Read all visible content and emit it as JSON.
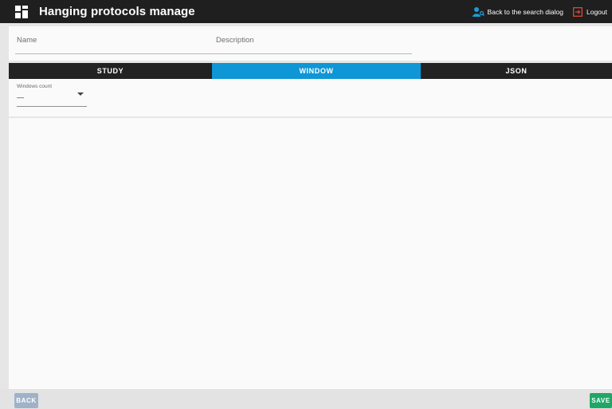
{
  "app": {
    "title": "Hanging protocols manage",
    "icon": "dashboard-icon"
  },
  "header": {
    "back_label": "Back to the search dialog",
    "back_icon": "user-search-icon",
    "logout_label": "Logout",
    "logout_icon": "logout-icon",
    "accent_icon_color": "#1e9bd7",
    "logout_icon_color": "#e74c3c"
  },
  "form": {
    "name_label": "Name",
    "name_value": "",
    "description_label": "Description",
    "description_value": ""
  },
  "tabs": [
    {
      "label": "STUDY",
      "active": false
    },
    {
      "label": "WINDOW",
      "active": true
    },
    {
      "label": "JSON",
      "active": false
    }
  ],
  "window": {
    "count_label": "Windows count",
    "count_value": "—",
    "count_arrow_icon": "dropdown-arrow-icon"
  },
  "footer": {
    "back_button": "BACK",
    "save_button": "SAVE"
  },
  "colors": {
    "topbar": "#1f1f1f",
    "active_tab": "#0e96d6",
    "save_button": "#1fa767",
    "back_button": "#9fb2c7"
  }
}
